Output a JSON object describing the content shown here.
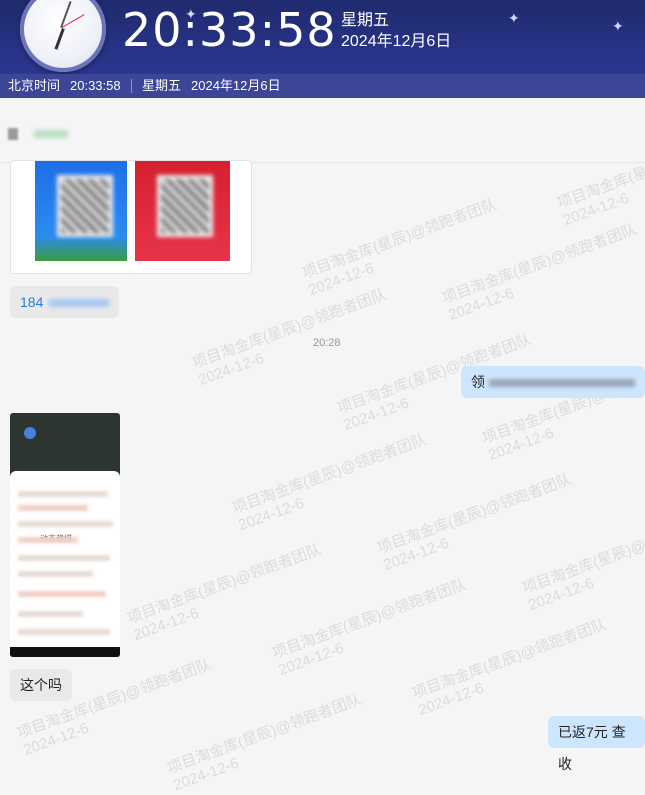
{
  "banner": {
    "time": "20:33:58",
    "weekday": "星期五",
    "date": "2024年12月6日"
  },
  "statusbar": {
    "label": "北京时间",
    "time": "20:33:58",
    "weekday": "星期五",
    "date": "2024年12月6日"
  },
  "chat": {
    "msg_phone_prefix": "184",
    "timestamp": "20:28",
    "out_prefix": "领",
    "msg_question": "这个吗",
    "msg_reply": "已返7元 查收",
    "screenshot_title": "动态趋描"
  },
  "watermark": {
    "line1": "项目淘金库(星辰)@领跑者团队",
    "line2": "2024-12-6"
  },
  "colors": {
    "banner": "#1f2a6e",
    "statusbar": "#3c4596",
    "bubble_out": "#cde6ff",
    "bubble_in": "#e9e9e9"
  }
}
